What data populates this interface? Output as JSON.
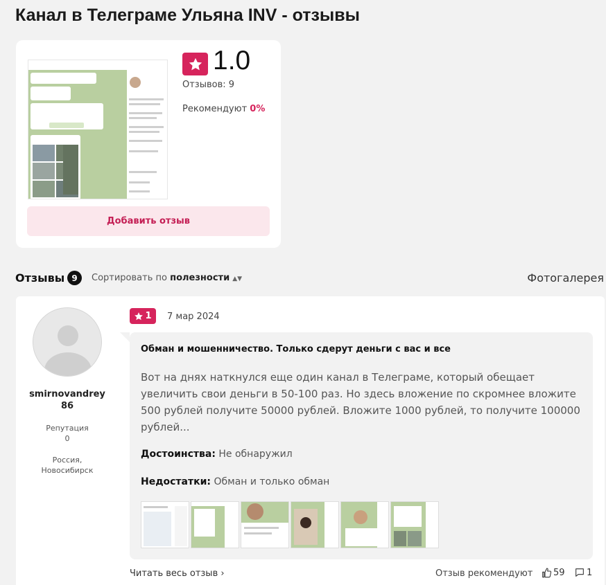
{
  "page": {
    "title": "Канал в Телеграме Ульяна INV - отзывы"
  },
  "product": {
    "rating": "1.0",
    "reviews_count_text": "Отзывов: 9",
    "recommend_label": "Рекомендуют",
    "recommend_pct": "0%",
    "add_review_label": "Добавить отзыв",
    "accent_color": "#d6245c"
  },
  "reviews_section": {
    "title": "Отзывы",
    "count": "9",
    "sort_prefix": "Сортировать по",
    "sort_value": "полезности",
    "gallery_label": "Фотогалерея"
  },
  "review": {
    "author": {
      "username": "smirnovandrey",
      "score": "86",
      "reputation_label": "Репутация",
      "reputation_value": "0",
      "location_line1": "Россия,",
      "location_line2": "Новосибирск"
    },
    "rating": "1",
    "date": "7 мар 2024",
    "heading": "Обман и мошенничество. Только сдерут деньги с вас и все",
    "text": "Вот на днях наткнулся еще один канал в Телеграме, который обещает увеличить свои деньги в 50-100 раз. Но здесь вложение по скромнее вложите 500 рублей получите 50000 рублей. Вложите 1000 рублей, то получите 100000 рублей...",
    "pros_label": "Достоинства:",
    "pros_value": "Не обнаружил",
    "cons_label": "Недостатки:",
    "cons_value": "Обман и только обман",
    "photos_count": 6,
    "read_full_label": "Читать весь отзыв",
    "recommend_label": "Отзыв рекомендуют",
    "likes": "59",
    "comments": "1"
  }
}
